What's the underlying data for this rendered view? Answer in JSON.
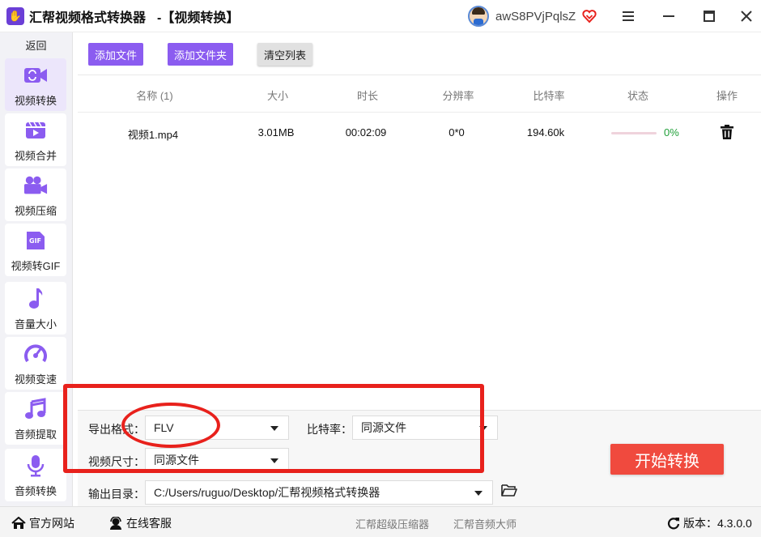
{
  "titlebar": {
    "app_name": "汇帮视频格式转换器",
    "subtitle": "-【视频转换】",
    "username": "awS8PVjPqlsZ"
  },
  "sidebar": {
    "back": "返回",
    "items": [
      {
        "label": "视频转换",
        "icon": "video-convert-icon",
        "active": true
      },
      {
        "label": "视频合并",
        "icon": "video-merge-icon"
      },
      {
        "label": "视频压缩",
        "icon": "video-compress-icon"
      },
      {
        "label": "视频转GIF",
        "icon": "gif-icon"
      },
      {
        "label": "音量大小",
        "icon": "music-note-icon"
      },
      {
        "label": "视频变速",
        "icon": "speedometer-icon"
      },
      {
        "label": "音频提取",
        "icon": "audio-extract-icon"
      },
      {
        "label": "音频转换",
        "icon": "microphone-icon"
      }
    ]
  },
  "toolbar": {
    "add_file": "添加文件",
    "add_folder": "添加文件夹",
    "clear_list": "清空列表"
  },
  "table": {
    "headers": [
      "名称 (1)",
      "大小",
      "时长",
      "分辨率",
      "比特率",
      "状态",
      "操作"
    ],
    "rows": [
      {
        "name": "视频1.mp4",
        "size": "3.01MB",
        "duration": "00:02:09",
        "resolution": "0*0",
        "bitrate": "194.60k",
        "progress_percent": 0,
        "status_text": "0%"
      }
    ]
  },
  "settings": {
    "format_label": "导出格式：",
    "format_value": "FLV",
    "bitrate_label": "比特率：",
    "bitrate_value": "同源文件",
    "size_label": "视频尺寸：",
    "size_value": "同源文件",
    "output_label": "输出目录：",
    "output_value": "C:/Users/ruguo/Desktop/汇帮视频格式转换器",
    "start_button": "开始转换"
  },
  "statusbar": {
    "website": "官方网站",
    "support": "在线客服",
    "link1": "汇帮超级压缩器",
    "link2": "汇帮音频大师",
    "version_label": "版本：",
    "version": "4.3.0.0"
  },
  "colors": {
    "accent": "#8b5cf0",
    "start": "#f04a3e",
    "highlight": "#e8211c",
    "progress_text": "#21a03a"
  }
}
